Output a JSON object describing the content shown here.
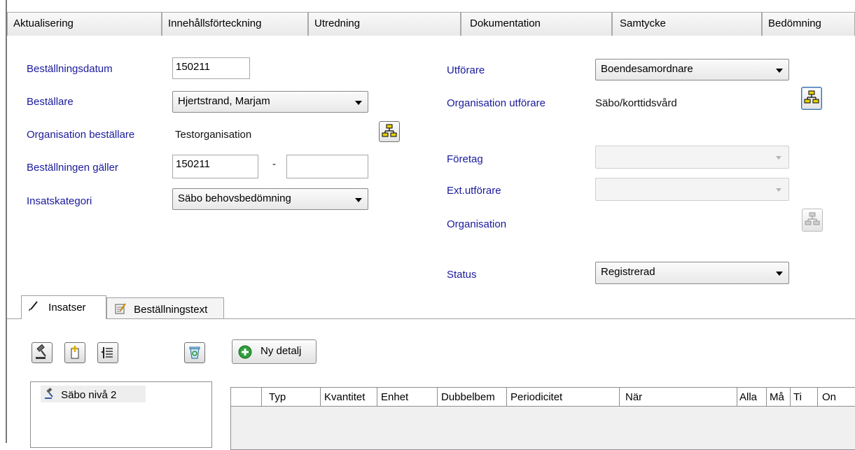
{
  "top_tabs": [
    "Aktualisering",
    "Innehållsförteckning",
    "Utredning",
    "Dokumentation",
    "Samtycke",
    "Bedömning"
  ],
  "form": {
    "bestallningsdatum": {
      "label": "Beställningsdatum",
      "value": "150211"
    },
    "bestallare": {
      "label": "Beställare",
      "value": "Hjertstrand, Marjam"
    },
    "org_bestallare": {
      "label": "Organisation beställare",
      "value": "Testorganisation"
    },
    "bestallningen_galler": {
      "label": "Beställningen gäller",
      "from": "150211",
      "separator": "-",
      "to": ""
    },
    "insatskategori": {
      "label": "Insatskategori",
      "value": "Säbo behovsbedömning"
    },
    "utforare": {
      "label": "Utförare",
      "value": "Boendesamordnare"
    },
    "org_utforare": {
      "label": "Organisation utförare",
      "value": "Säbo/korttidsvård"
    },
    "foretag": {
      "label": "Företag",
      "value": ""
    },
    "ext_utforare": {
      "label": "Ext.utförare",
      "value": ""
    },
    "organisation": {
      "label": "Organisation"
    },
    "status": {
      "label": "Status",
      "value": "Registrerad"
    }
  },
  "sub_tabs": [
    {
      "label": "Insatser",
      "icon": "pen-icon"
    },
    {
      "label": "Beställningstext",
      "icon": "notepad-icon"
    }
  ],
  "toolbar": {
    "ny_detalj": "Ny detalj"
  },
  "tree": {
    "item": "Säbo nivå 2"
  },
  "grid": {
    "columns": [
      "",
      "Typ",
      "Kvantitet",
      "Enhet",
      "Dubbelbem",
      "Periodicitet",
      "När",
      "Alla",
      "Må",
      "Ti",
      "On"
    ]
  },
  "colors": {
    "label": "#1a1a9c",
    "tab_border": "#a9a9a9"
  }
}
